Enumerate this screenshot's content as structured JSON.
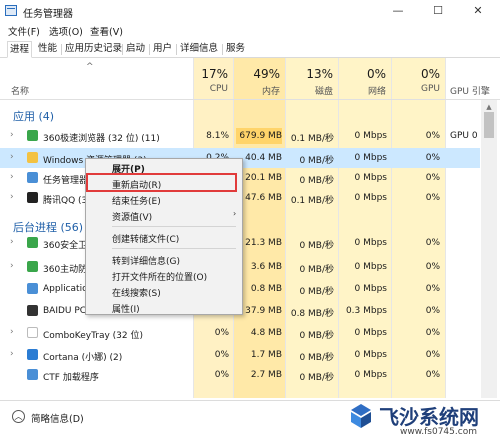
{
  "window": {
    "title": "任务管理器",
    "min_glyph": "—",
    "max_glyph": "☐",
    "close_glyph": "✕"
  },
  "menu": [
    "文件(F)",
    "选项(O)",
    "查看(V)"
  ],
  "tabs": [
    "进程",
    "性能",
    "应用历史记录",
    "启动",
    "用户",
    "详细信息",
    "服务"
  ],
  "active_tab": "进程",
  "header": {
    "sort_caret": "^",
    "name": "名称",
    "cpu": {
      "pct": "17%",
      "label": "CPU"
    },
    "memory": {
      "pct": "49%",
      "label": "内存"
    },
    "disk": {
      "pct": "13%",
      "label": "磁盘"
    },
    "network": {
      "pct": "0%",
      "label": "网络"
    },
    "gpu": {
      "pct": "0%",
      "label": "GPU"
    },
    "gpu_engine": {
      "label": "GPU 引擎"
    }
  },
  "groups": {
    "apps": "应用 (4)",
    "background": "后台进程 (56)"
  },
  "rows": [
    {
      "name": "360极速浏览器 (32 位) (11)",
      "cpu": "8.1%",
      "mem": "679.9 MB",
      "disk": "0.1 MB/秒",
      "net": "0 Mbps",
      "gpu": "0%",
      "gpu_engine": "GPU 0",
      "icon": "browser-icon",
      "color": "#3aa64b"
    },
    {
      "name": "Windows 资源管理器 (3)",
      "cpu": "0.2%",
      "mem": "40.4 MB",
      "disk": "0 MB/秒",
      "net": "0 Mbps",
      "gpu": "0%",
      "gpu_engine": "",
      "icon": "folder-icon",
      "color": "#f3c242"
    },
    {
      "name": "任务管理器",
      "cpu": "",
      "mem": "20.1 MB",
      "disk": "0 MB/秒",
      "net": "0 Mbps",
      "gpu": "0%",
      "gpu_engine": "",
      "icon": "taskmgr-icon",
      "color": "#4a8fd6"
    },
    {
      "name": "腾讯QQ (32",
      "cpu": "",
      "mem": "47.6 MB",
      "disk": "0.1 MB/秒",
      "net": "0 Mbps",
      "gpu": "0%",
      "gpu_engine": "",
      "icon": "qq-icon",
      "color": "#222222"
    },
    {
      "name": "360安全卫",
      "cpu": "",
      "mem": "21.3 MB",
      "disk": "0 MB/秒",
      "net": "0 Mbps",
      "gpu": "0%",
      "gpu_engine": "",
      "icon": "shield-icon",
      "color": "#3aa64b"
    },
    {
      "name": "360主动防",
      "cpu": "",
      "mem": "3.6 MB",
      "disk": "0 MB/秒",
      "net": "0 Mbps",
      "gpu": "0%",
      "gpu_engine": "",
      "icon": "guard-icon",
      "color": "#3aa64b"
    },
    {
      "name": "Applicatio",
      "cpu": "",
      "mem": "0.8 MB",
      "disk": "0 MB/秒",
      "net": "0 Mbps",
      "gpu": "0%",
      "gpu_engine": "",
      "icon": "app-frame-icon",
      "color": "#4a8fd6"
    },
    {
      "name": "BAIDU PCI",
      "cpu": "",
      "mem": "37.9 MB",
      "disk": "0.8 MB/秒",
      "net": "0.3 Mbps",
      "gpu": "0%",
      "gpu_engine": "",
      "icon": "baidu-icon",
      "color": "#333333"
    },
    {
      "name": "ComboKeyTray (32 位)",
      "cpu": "0%",
      "mem": "4.8 MB",
      "disk": "0 MB/秒",
      "net": "0 Mbps",
      "gpu": "0%",
      "gpu_engine": "",
      "icon": "blank-icon",
      "color": "#ffffff"
    },
    {
      "name": "Cortana (小娜) (2)",
      "cpu": "0%",
      "mem": "1.7 MB",
      "disk": "0 MB/秒",
      "net": "0 Mbps",
      "gpu": "0%",
      "gpu_engine": "",
      "icon": "cortana-icon",
      "color": "#2b7cd3"
    },
    {
      "name": "CTF 加载程序",
      "cpu": "0%",
      "mem": "2.7 MB",
      "disk": "0 MB/秒",
      "net": "0 Mbps",
      "gpu": "0%",
      "gpu_engine": "",
      "icon": "ctf-icon",
      "color": "#4a8fd6"
    }
  ],
  "context_menu": {
    "items": [
      "展开(P)",
      "重新启动(R)",
      "结束任务(E)",
      "资源值(V)",
      "创建转储文件(C)",
      "转到详细信息(G)",
      "打开文件所在的位置(O)",
      "在线搜索(S)",
      "属性(I)"
    ],
    "highlighted": "重新启动(R)",
    "submenu_arrow": "›"
  },
  "footer": {
    "fewer_details": "简略信息(D)"
  },
  "watermark": {
    "brand": "飞沙系统网",
    "url": "www.fs0745.com"
  },
  "colors": {
    "group_title": "#1f5fa8",
    "highlight_row": "#cce8ff",
    "heat_cell": "#ffe9a8",
    "red_box": "#e13b3b"
  }
}
